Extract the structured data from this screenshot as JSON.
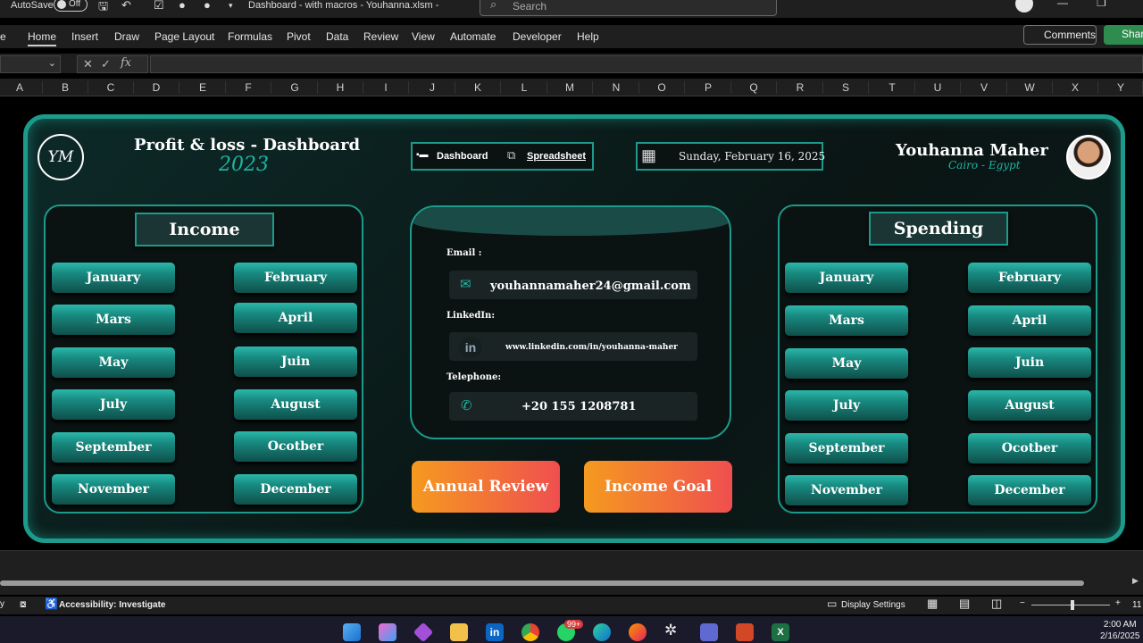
{
  "titlebar": {
    "autosave": "AutoSave",
    "toggle": "Off",
    "doc_title": "Dashboard - with macros - Youhanna.xlsm  -",
    "search_placeholder": "Search"
  },
  "ribbon": {
    "tabs": [
      "e",
      "Home",
      "Insert",
      "Draw",
      "Page Layout",
      "Formulas",
      "Pivot",
      "Data",
      "Review",
      "View",
      "Automate",
      "Developer",
      "Help"
    ],
    "comments": "Comments",
    "share": "Share"
  },
  "formula": {
    "fx": "fx"
  },
  "columns": [
    "A",
    "B",
    "C",
    "D",
    "E",
    "F",
    "G",
    "H",
    "I",
    "J",
    "K",
    "L",
    "M",
    "N",
    "O",
    "P",
    "Q",
    "R",
    "S",
    "T",
    "U",
    "V",
    "W",
    "X",
    "Y"
  ],
  "dashboard": {
    "logo": "YM",
    "title": "Profit & loss - Dashboard",
    "year": "2023",
    "nav": {
      "dashboard": "Dashboard",
      "spreadsheet": "Spreadsheet"
    },
    "date": "Sunday, February 16, 2025",
    "author": {
      "name": "Youhanna Maher",
      "location": "Cairo - Egypt"
    },
    "income": {
      "title": "Income",
      "months": [
        "January",
        "February",
        "Mars",
        "April",
        "May",
        "Juin",
        "July",
        "August",
        "September",
        "Ocotber",
        "November",
        "December"
      ]
    },
    "spending": {
      "title": "Spending",
      "months": [
        "January",
        "February",
        "Mars",
        "April",
        "May",
        "Juin",
        "July",
        "August",
        "September",
        "Ocotber",
        "November",
        "December"
      ]
    },
    "contact": {
      "email_label": "Email :",
      "email": "youhannamaher24@gmail.com",
      "linkedin_label": "LinkedIn:",
      "linkedin": "www.linkedin.com/in/youhanna-maher",
      "telephone_label": "Telephone:",
      "telephone": "+20 155 1208781"
    },
    "buttons": {
      "annual_review": "Annual Review",
      "income_goal": "Income Goal"
    }
  },
  "status": {
    "accessibility": "Accessibility: Investigate",
    "display_settings": "Display Settings",
    "zoom_partial": "11"
  },
  "taskbar": {
    "badge": "99+",
    "time": "2:00 AM",
    "date": "2/16/2025"
  }
}
